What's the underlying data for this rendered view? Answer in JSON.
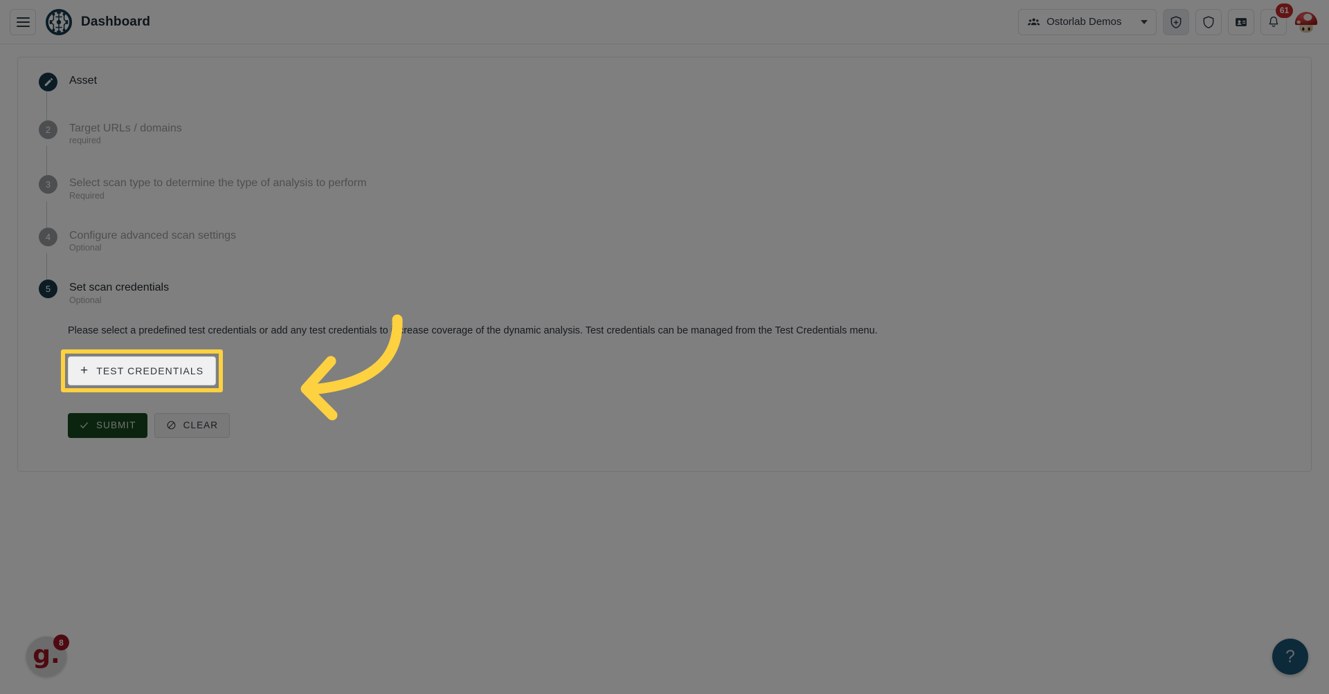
{
  "header": {
    "menu_icon": "hamburger-menu-icon",
    "logo_icon": "ostorlab-circuit-logo",
    "title": "Dashboard",
    "org_selector": {
      "icon": "group-people-icon",
      "value": "Ostorlab Demos",
      "caret_icon": "chevron-down-icon"
    },
    "actions": [
      {
        "name": "add-scan-button",
        "icon": "shield-plus-icon",
        "selected": true
      },
      {
        "name": "security-button",
        "icon": "shield-icon",
        "selected": false
      },
      {
        "name": "tickets-button",
        "icon": "id-card-icon",
        "selected": false
      }
    ],
    "notifications": {
      "icon": "bell-icon",
      "count": "61"
    },
    "avatar": {
      "icon": "mushroom-avatar",
      "alt": "User avatar"
    }
  },
  "wizard": {
    "steps": [
      {
        "number": "1",
        "indicator": "edit-pencil-icon",
        "label": "Asset",
        "sub": "",
        "state": "completed"
      },
      {
        "number": "2",
        "indicator": "2",
        "label": "Target URLs / domains",
        "sub": "required",
        "state": "inactive"
      },
      {
        "number": "3",
        "indicator": "3",
        "label": "Select scan type to determine the type of analysis to perform",
        "sub": "Required",
        "state": "inactive"
      },
      {
        "number": "4",
        "indicator": "4",
        "label": "Configure advanced scan settings",
        "sub": "Optional",
        "state": "inactive"
      },
      {
        "number": "5",
        "indicator": "5",
        "label": "Set scan credentials",
        "sub": "Optional",
        "state": "active"
      }
    ]
  },
  "credentials_panel": {
    "description": "Please select a predefined test credentials or add any test credentials to increase coverage of the dynamic analysis. Test credentials can be managed from the Test Credentials menu.",
    "add_button": {
      "plus_icon": "plus-icon",
      "label": "TEST CREDENTIALS"
    },
    "submit_button": {
      "check_icon": "check-icon",
      "label": "SUBMIT"
    },
    "clear_button": {
      "block_icon": "block-circle-slash-icon",
      "label": "CLEAR"
    }
  },
  "annotation": {
    "arrow_icon": "curved-left-arrow-annotation",
    "color": "#fdd140",
    "highlight_target": "TEST CREDENTIALS"
  },
  "widgets": {
    "guide": {
      "icon": "guide-g-logo",
      "mark": "g.",
      "badge": "8"
    },
    "help": {
      "icon": "question-mark-icon",
      "label": "?"
    }
  },
  "colors": {
    "accent_dark": "#17394b",
    "highlight_yellow": "#fdd140",
    "submit_green": "#17491f",
    "badge_red": "#c62828",
    "help_blue": "#1a5574",
    "overlay": "rgba(0,0,0,0.5)"
  }
}
